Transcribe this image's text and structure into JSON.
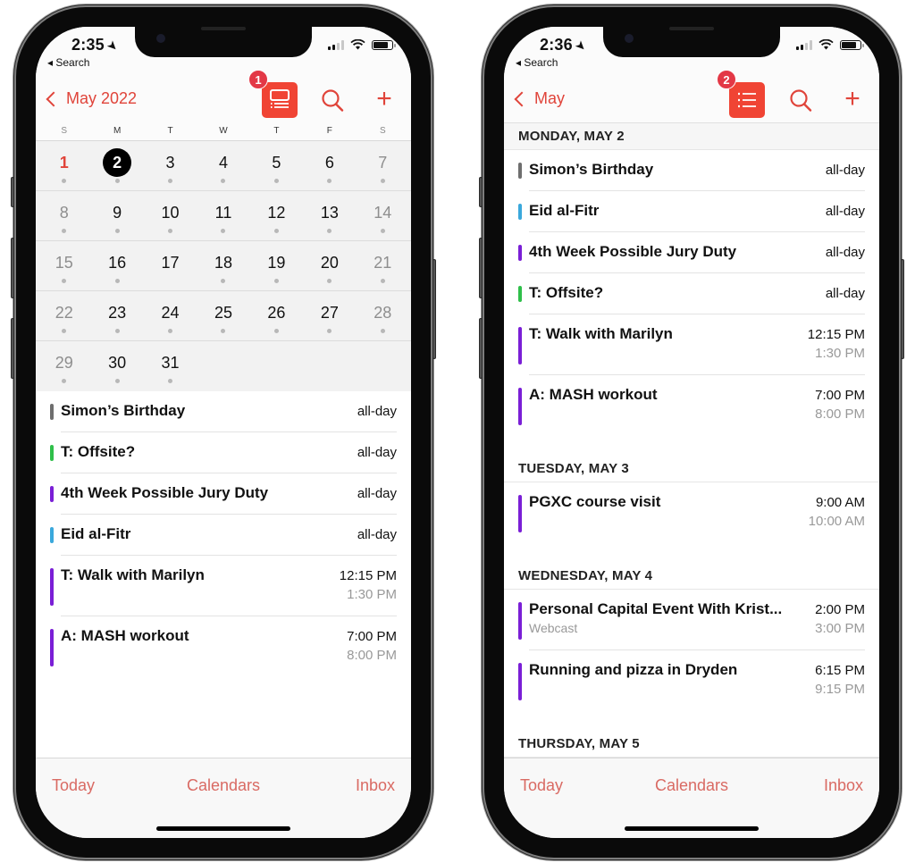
{
  "colors": {
    "accent": "#e0443a",
    "toggle_bg": "#f04434",
    "badge_bg": "#e33846",
    "cal_gray": "#6e6e6e",
    "cal_green": "#2fbf4a",
    "cal_purple": "#7a1fd6",
    "cal_blue": "#3aa8dc"
  },
  "left_phone": {
    "status": {
      "time": "2:35",
      "back_label": "Search"
    },
    "nav": {
      "back_title": "May 2022",
      "badge": "1"
    },
    "weekdays": [
      "S",
      "M",
      "T",
      "W",
      "T",
      "F",
      "S"
    ],
    "weeks": [
      [
        {
          "d": "1",
          "dot": true,
          "red": true
        },
        {
          "d": "2",
          "dot": true,
          "selected": true
        },
        {
          "d": "3",
          "dot": true
        },
        {
          "d": "4",
          "dot": true
        },
        {
          "d": "5",
          "dot": true
        },
        {
          "d": "6",
          "dot": true
        },
        {
          "d": "7",
          "dot": true
        }
      ],
      [
        {
          "d": "8",
          "dot": true
        },
        {
          "d": "9",
          "dot": true
        },
        {
          "d": "10",
          "dot": true
        },
        {
          "d": "11",
          "dot": true
        },
        {
          "d": "12",
          "dot": true
        },
        {
          "d": "13",
          "dot": true
        },
        {
          "d": "14",
          "dot": true
        }
      ],
      [
        {
          "d": "15",
          "dot": true
        },
        {
          "d": "16",
          "dot": true
        },
        {
          "d": "17",
          "dot": false
        },
        {
          "d": "18",
          "dot": true
        },
        {
          "d": "19",
          "dot": true
        },
        {
          "d": "20",
          "dot": true
        },
        {
          "d": "21",
          "dot": true
        }
      ],
      [
        {
          "d": "22",
          "dot": true
        },
        {
          "d": "23",
          "dot": true
        },
        {
          "d": "24",
          "dot": true
        },
        {
          "d": "25",
          "dot": true
        },
        {
          "d": "26",
          "dot": true
        },
        {
          "d": "27",
          "dot": true
        },
        {
          "d": "28",
          "dot": true
        }
      ],
      [
        {
          "d": "29",
          "dot": true
        },
        {
          "d": "30",
          "dot": true
        },
        {
          "d": "31",
          "dot": true
        }
      ]
    ],
    "events": [
      {
        "title": "Simon’s Birthday",
        "start": "all-day",
        "color": "gray"
      },
      {
        "title": "T: Offsite?",
        "start": "all-day",
        "color": "green"
      },
      {
        "title": "4th Week Possible Jury Duty",
        "start": "all-day",
        "color": "purple"
      },
      {
        "title": "Eid al-Fitr",
        "start": "all-day",
        "color": "blue"
      },
      {
        "title": "T: Walk with Marilyn",
        "start": "12:15 PM",
        "end": "1:30 PM",
        "color": "purple"
      },
      {
        "title": "A: MASH workout",
        "start": "7:00 PM",
        "end": "8:00 PM",
        "color": "purple"
      }
    ],
    "tabs": {
      "today": "Today",
      "calendars": "Calendars",
      "inbox": "Inbox"
    }
  },
  "right_phone": {
    "status": {
      "time": "2:36",
      "back_label": "Search"
    },
    "nav": {
      "back_title": "May",
      "badge": "2"
    },
    "days": [
      {
        "header": "MONDAY, MAY 2",
        "events": [
          {
            "title": "Simon’s Birthday",
            "start": "all-day",
            "color": "gray"
          },
          {
            "title": "Eid al-Fitr",
            "start": "all-day",
            "color": "blue"
          },
          {
            "title": "4th Week Possible Jury Duty",
            "start": "all-day",
            "color": "purple"
          },
          {
            "title": "T: Offsite?",
            "start": "all-day",
            "color": "green"
          },
          {
            "title": "T: Walk with Marilyn",
            "start": "12:15 PM",
            "end": "1:30 PM",
            "color": "purple"
          },
          {
            "title": "A: MASH workout",
            "start": "7:00 PM",
            "end": "8:00 PM",
            "color": "purple"
          }
        ]
      },
      {
        "header": "TUESDAY, MAY 3",
        "events": [
          {
            "title": "PGXC course visit",
            "start": "9:00 AM",
            "end": "10:00 AM",
            "color": "purple"
          }
        ]
      },
      {
        "header": "WEDNESDAY, MAY 4",
        "events": [
          {
            "title": "Personal Capital Event With Krist...",
            "subtitle": "Webcast",
            "start": "2:00 PM",
            "end": "3:00 PM",
            "color": "purple"
          },
          {
            "title": "Running and pizza in Dryden",
            "start": "6:15 PM",
            "end": "9:15 PM",
            "color": "purple"
          }
        ]
      },
      {
        "header": "THURSDAY, MAY 5",
        "events": []
      }
    ],
    "tabs": {
      "today": "Today",
      "calendars": "Calendars",
      "inbox": "Inbox"
    }
  }
}
